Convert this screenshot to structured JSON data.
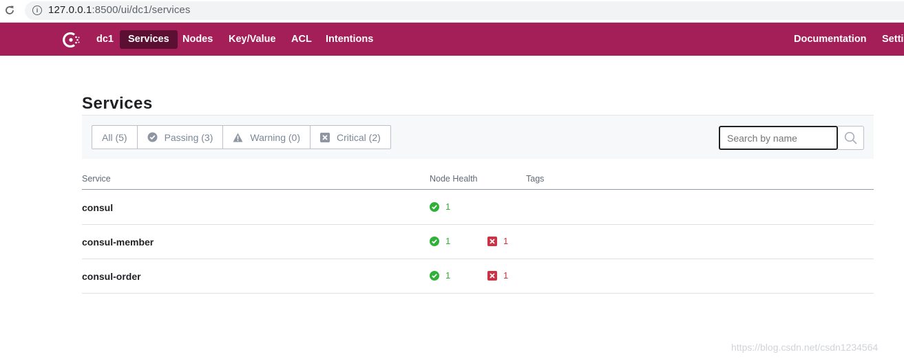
{
  "browser": {
    "url_host": "127.0.0.1",
    "url_path": ":8500/ui/dc1/services"
  },
  "nav": {
    "datacenter": "dc1",
    "items": [
      {
        "label": "Services",
        "active": true
      },
      {
        "label": "Nodes"
      },
      {
        "label": "Key/Value"
      },
      {
        "label": "ACL"
      },
      {
        "label": "Intentions"
      }
    ],
    "right_items": [
      {
        "label": "Documentation"
      },
      {
        "label": "Settings"
      }
    ]
  },
  "page": {
    "title": "Services"
  },
  "filters": [
    {
      "label": "All (5)",
      "icon": "none"
    },
    {
      "label": "Passing (3)",
      "icon": "check-circle-icon"
    },
    {
      "label": "Warning (0)",
      "icon": "warning-triangle-icon"
    },
    {
      "label": "Critical (2)",
      "icon": "x-square-icon"
    }
  ],
  "search": {
    "placeholder": "Search by name",
    "value": ""
  },
  "table": {
    "columns": [
      "Service",
      "Node Health",
      "Tags"
    ],
    "rows": [
      {
        "name": "consul",
        "passing": "1",
        "critical": ""
      },
      {
        "name": "consul-member",
        "passing": "1",
        "critical": "1"
      },
      {
        "name": "consul-order",
        "passing": "1",
        "critical": "1"
      }
    ]
  },
  "watermark": "https://blog.csdn.net/csdn1234564",
  "colors": {
    "brand": "#a41e58",
    "nav_active": "#5b1033",
    "passing": "#2eb039",
    "critical": "#c73445"
  }
}
